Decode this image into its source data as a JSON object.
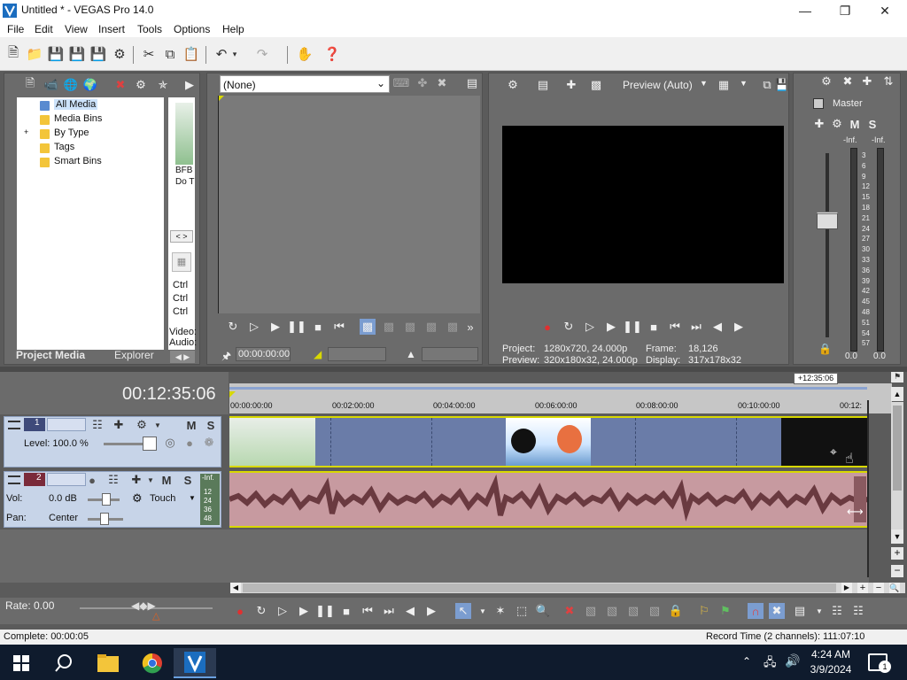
{
  "window": {
    "title": "Untitled * - VEGAS Pro 14.0"
  },
  "menu": [
    "File",
    "Edit",
    "View",
    "Insert",
    "Tools",
    "Options",
    "Help"
  ],
  "project_media": {
    "tree": [
      "All Media",
      "Media Bins",
      "By Type",
      "Tags",
      "Smart Bins"
    ],
    "thumb_label": "BFB Do T",
    "shortcut_labels": [
      "Ctrl",
      "Ctrl",
      "Ctrl"
    ],
    "info_labels": [
      "Video:",
      "Audio:"
    ],
    "tabs": {
      "project_media": "Project Media",
      "explorer": "Explorer"
    }
  },
  "trimmer": {
    "dropdown": "(None)",
    "timecode": "00:00:00:00"
  },
  "preview": {
    "mode": "Preview (Auto)",
    "project_label": "Project:",
    "project_value": "1280x720, 24.000p",
    "preview_label": "Preview:",
    "preview_value": "320x180x32, 24.000p",
    "frame_label": "Frame:",
    "frame_value": "18,126",
    "display_label": "Display:",
    "display_value": "317x178x32"
  },
  "mixer": {
    "title": "Master",
    "left_inf": "-Inf.",
    "right_inf": "-Inf.",
    "scale": [
      "3",
      "6",
      "9",
      "12",
      "15",
      "18",
      "21",
      "24",
      "27",
      "30",
      "33",
      "36",
      "39",
      "42",
      "45",
      "48",
      "51",
      "54",
      "57"
    ],
    "left_value": "0.0",
    "right_value": "0.0"
  },
  "timeline": {
    "timecode": "00:12:35:06",
    "end_badge": "+12:35:06",
    "ruler": [
      "00:00:00:00",
      "00:02:00:00",
      "00:04:00:00",
      "00:06:00:00",
      "00:08:00:00",
      "00:10:00:00",
      "00:12:"
    ]
  },
  "video_track": {
    "number": "1",
    "level": "Level: 100.0 %"
  },
  "audio_track": {
    "number": "2",
    "vol_label": "Vol:",
    "vol_value": "0.0 dB",
    "pan_label": "Pan:",
    "pan_value": "Center",
    "mode": "Touch",
    "meter_inf": "-Inf.",
    "meter_scale": [
      "12",
      "24",
      "36",
      "48"
    ]
  },
  "rate": {
    "label": "Rate: 0.00"
  },
  "status": {
    "complete": "Complete: 00:00:05",
    "record_time": "Record Time (2 channels): 111:07:10"
  },
  "taskbar": {
    "time": "4:24 AM",
    "date": "3/9/2024",
    "notifications": "1"
  }
}
